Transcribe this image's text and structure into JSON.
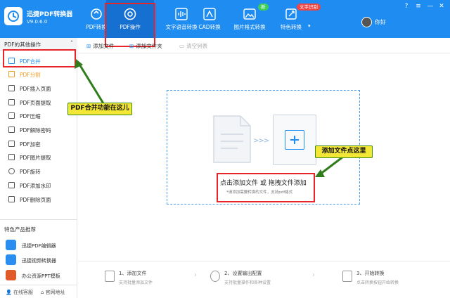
{
  "app": {
    "title": "迅捷PDF转换器",
    "version": "V9.0.6.0"
  },
  "nav": [
    {
      "label": "PDF转换",
      "icon": "refresh-icon"
    },
    {
      "label": "PDF操作",
      "icon": "gear-circle-icon"
    },
    {
      "label": "文字语音转换",
      "icon": "audio-wave-icon"
    },
    {
      "label": "CAD转换",
      "icon": "cad-icon"
    },
    {
      "label": "图片格式转换",
      "icon": "image-icon"
    },
    {
      "label": "特色转换",
      "icon": "magic-icon"
    }
  ],
  "badges": {
    "new": "新",
    "text_recognition": "文字识别"
  },
  "user": {
    "name": "你好"
  },
  "window": {
    "help": "?",
    "menu": "≡",
    "minimize": "—",
    "close": "✕"
  },
  "sidebar": {
    "header": "PDF的其他操作",
    "items": [
      {
        "label": "PDF合并"
      },
      {
        "label": "PDF分割"
      },
      {
        "label": "PDF插入页面"
      },
      {
        "label": "PDF页面提取"
      },
      {
        "label": "PDF压缩"
      },
      {
        "label": "PDF解除密码"
      },
      {
        "label": "PDF加密"
      },
      {
        "label": "PDF图片提取"
      },
      {
        "label": "PDF旋转"
      },
      {
        "label": "PDF添加水印"
      },
      {
        "label": "PDF删除页面"
      }
    ],
    "recommend_title": "特色产品推荐",
    "recommend": [
      {
        "label": "迅捷PDF编辑器",
        "color": "#2a8ef0"
      },
      {
        "label": "迅捷视频转换器",
        "color": "#2a8ef0"
      },
      {
        "label": "办公资源PPT模板",
        "color": "#e05a2a"
      }
    ],
    "footer": {
      "service": "在线客服",
      "website": "官网地址"
    }
  },
  "toolbar": {
    "add_file": "添加文件",
    "add_folder": "添加文件夹",
    "clear_list": "清空列表"
  },
  "dropzone": {
    "main_text": "点击添加文件 或 拖拽文件添加",
    "hint": "*请添加需要转换的文件，支持pdf格式"
  },
  "callouts": {
    "merge": "PDF合并功能在这儿",
    "add": "添加文件点这里"
  },
  "steps": [
    {
      "title": "1、添加文件",
      "desc": "支持批量添加文件"
    },
    {
      "title": "2、设置输出配置",
      "desc": "支持批量操作和各种设置"
    },
    {
      "title": "3、开始转换",
      "desc": "点击转换按钮开始转换"
    }
  ],
  "colors": {
    "primary": "#1e8cf0",
    "highlight": "#e8262a",
    "callout": "#f3e635"
  }
}
